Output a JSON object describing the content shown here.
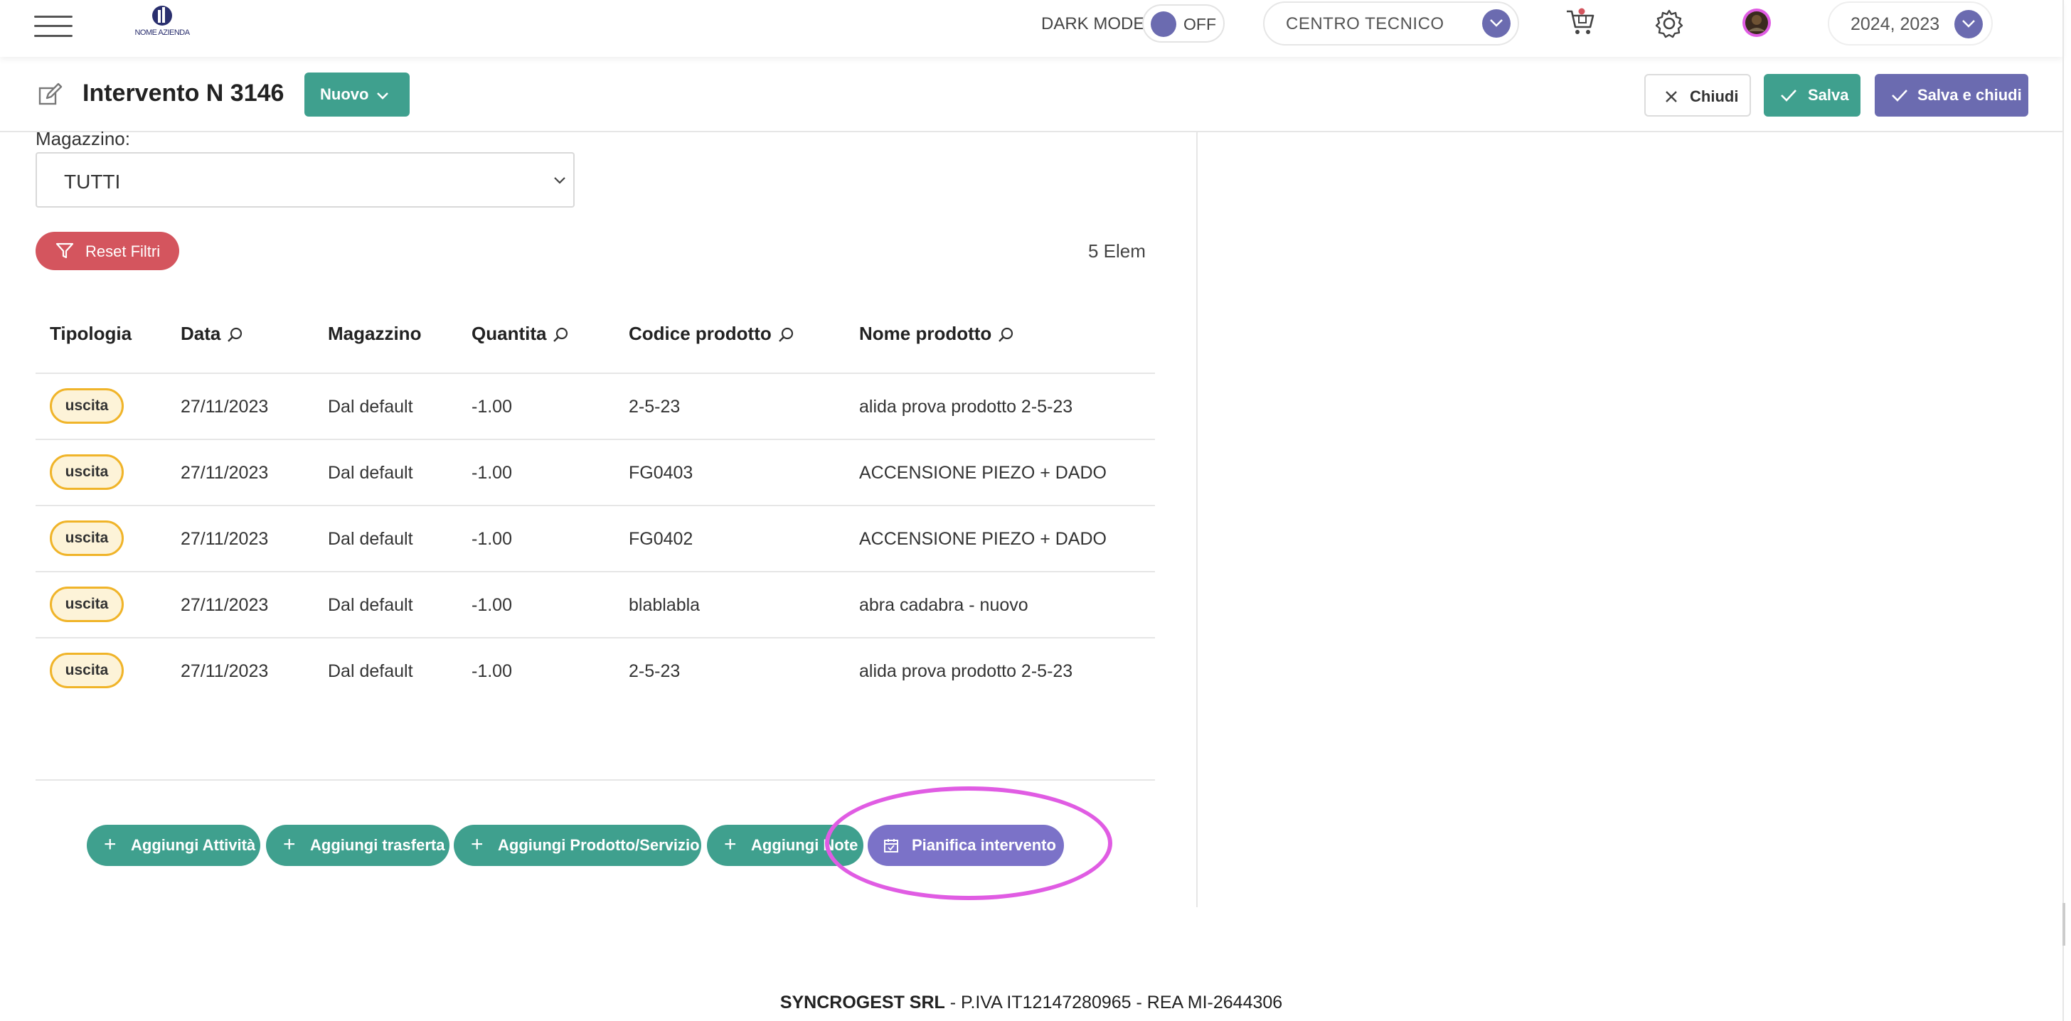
{
  "topbar": {
    "logo_text": "NOME AZIENDA",
    "dark_mode_label": "DARK MODE",
    "dark_mode_state": "OFF",
    "center_select": "CENTRO TECNICO",
    "year_select": "2024, 2023",
    "icons": [
      "menu-icon",
      "cart-icon",
      "gear-icon",
      "avatar"
    ]
  },
  "header": {
    "title": "Intervento N 3146",
    "nuovo_label": "Nuovo",
    "chiudi_label": "Chiudi",
    "salva_label": "Salva",
    "salva_chiudi_label": "Salva e chiudi"
  },
  "filters": {
    "magazzino_label": "Magazzino:",
    "magazzino_value": "TUTTI",
    "reset_label": "Reset Filtri",
    "count_text": "5 Elem"
  },
  "table": {
    "columns": [
      "Tipologia",
      "Data",
      "Magazzino",
      "Quantita",
      "Codice prodotto",
      "Nome prodotto"
    ],
    "rows": [
      {
        "tipologia": "uscita",
        "data": "27/11/2023",
        "magazzino": "Dal default",
        "quantita": "-1.00",
        "codice": "2-5-23",
        "nome": "alida prova prodotto 2-5-23"
      },
      {
        "tipologia": "uscita",
        "data": "27/11/2023",
        "magazzino": "Dal default",
        "quantita": "-1.00",
        "codice": "FG0403",
        "nome": "ACCENSIONE PIEZO + DADO"
      },
      {
        "tipologia": "uscita",
        "data": "27/11/2023",
        "magazzino": "Dal default",
        "quantita": "-1.00",
        "codice": "FG0402",
        "nome": "ACCENSIONE PIEZO + DADO"
      },
      {
        "tipologia": "uscita",
        "data": "27/11/2023",
        "magazzino": "Dal default",
        "quantita": "-1.00",
        "codice": "blablabla",
        "nome": "abra cadabra - nuovo"
      },
      {
        "tipologia": "uscita",
        "data": "27/11/2023",
        "magazzino": "Dal default",
        "quantita": "-1.00",
        "codice": "2-5-23",
        "nome": "alida prova prodotto 2-5-23"
      }
    ]
  },
  "actions": {
    "aggiungi_attivita": "Aggiungi Attività",
    "aggiungi_trasferta": "Aggiungi trasferta",
    "aggiungi_prodotto": "Aggiungi Prodotto/Servizio",
    "aggiungi_note": "Aggiungi Note",
    "pianifica": "Pianifica intervento"
  },
  "footer": {
    "company": "SYNCROGEST SRL",
    "details": " - P.IVA IT12147280965 - REA MI-2644306"
  },
  "colors": {
    "primary_teal": "#3fa08e",
    "accent_purple": "#6b6bb0",
    "danger_red": "#d4555e",
    "badge_yellow": "#f0b429",
    "highlight_magenta": "#e05ce3"
  }
}
